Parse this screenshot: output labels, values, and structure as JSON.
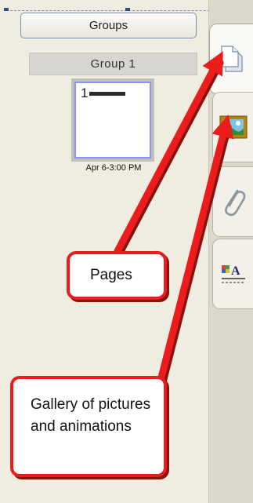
{
  "left_panel": {
    "groups_button": "Groups",
    "group_header": "Group 1",
    "thumbnail": {
      "page_number": "1",
      "caption": "Apr 6-3:00 PM"
    }
  },
  "tabs": [
    {
      "name": "Pages",
      "icon": "page-icon",
      "active": true
    },
    {
      "name": "Gallery",
      "icon": "picture-icon",
      "active": false
    },
    {
      "name": "Attachments",
      "icon": "paperclip-icon",
      "active": false
    },
    {
      "name": "Properties",
      "icon": "fill-text-icon",
      "active": false
    }
  ],
  "callouts": {
    "pages": "Pages",
    "gallery": "Gallery of pictures and animations"
  },
  "colors": {
    "callout_accent": "#ea1c1c",
    "selection": "#2f4f8f"
  }
}
